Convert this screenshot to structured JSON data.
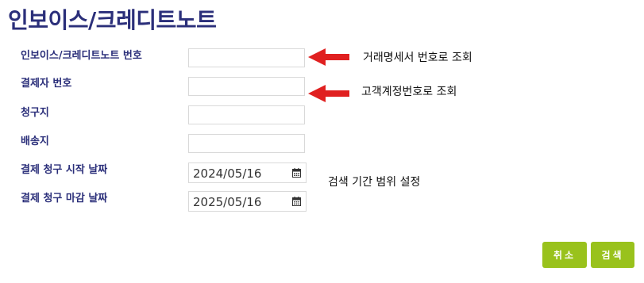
{
  "page": {
    "title": "인보이스/크레디트노트"
  },
  "form": {
    "invoice_number": {
      "label": "인보이스/크레디트노트 번호",
      "value": ""
    },
    "payer_number": {
      "label": "결제자 번호",
      "value": ""
    },
    "bill_to": {
      "label": "청구지",
      "value": ""
    },
    "ship_to": {
      "label": "배송지",
      "value": ""
    },
    "billing_start_date": {
      "label": "결제 청구 시작 날짜",
      "value": "2024/05/16"
    },
    "billing_end_date": {
      "label": "결제 청구 마감 날짜",
      "value": "2025/05/16"
    }
  },
  "annotations": {
    "invoice_note": "거래명세서 번호로 조회",
    "payer_note": "고객계정번호로 조회",
    "date_note": "검색 기간 범위 설정",
    "arrow_color": "#e02020"
  },
  "buttons": {
    "cancel_label": "취소",
    "search_label": "검색",
    "button_color": "#99c21c"
  },
  "colors": {
    "title": "#2b2f7a",
    "label": "#2b2f7a"
  }
}
